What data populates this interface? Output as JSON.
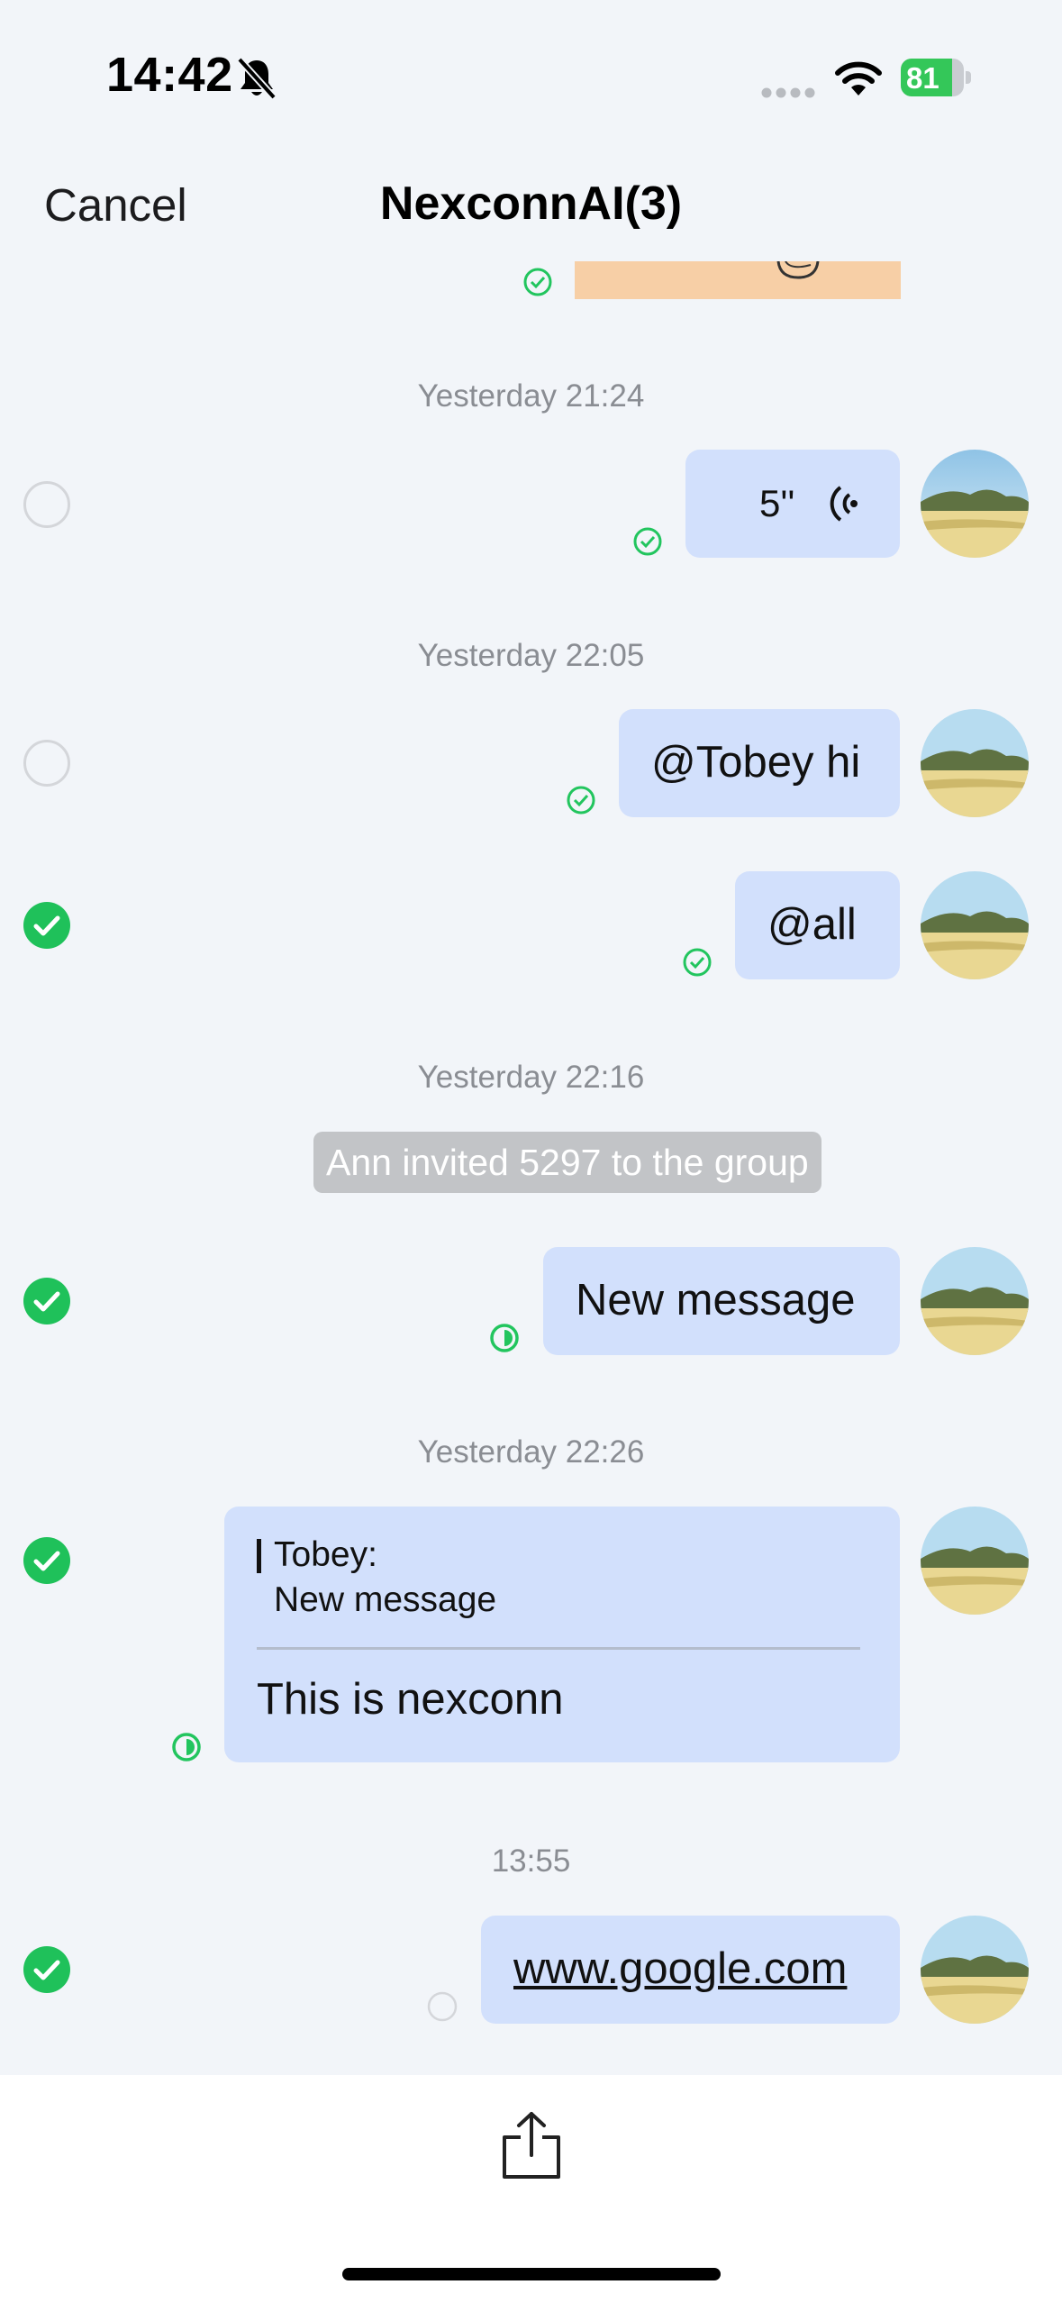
{
  "status_bar": {
    "time": "14:42",
    "battery_level": "81",
    "battery_fraction": 0.81
  },
  "nav": {
    "cancel_label": "Cancel",
    "title": "NexconnAI(3)"
  },
  "messages": [
    {
      "type": "image",
      "partial": true,
      "read_status": "read"
    },
    {
      "timestamp": "Yesterday 21:24"
    },
    {
      "type": "voice",
      "duration": "5''",
      "selected": false,
      "read_status": "read"
    },
    {
      "timestamp": "Yesterday 22:05"
    },
    {
      "type": "text",
      "text": "@Tobey hi",
      "selected": false,
      "read_status": "read"
    },
    {
      "type": "text",
      "text": "@all",
      "selected": true,
      "read_status": "read"
    },
    {
      "timestamp": "Yesterday 22:16"
    },
    {
      "type": "notice",
      "text": "Ann invited 5297 to the group"
    },
    {
      "type": "text",
      "text": "New message",
      "selected": true,
      "read_status": "partial"
    },
    {
      "timestamp": "Yesterday 22:26"
    },
    {
      "type": "reply",
      "quote_author": "Tobey:",
      "quote_text": "New message",
      "text": "This is nexconn",
      "selected": true,
      "read_status": "partial"
    },
    {
      "timestamp": "13:55"
    },
    {
      "type": "link",
      "text": "www.google.com",
      "selected": true,
      "read_status": "unread"
    }
  ],
  "colors": {
    "background": "#f2f5f9",
    "bubble": "#d2e0fc",
    "accent_green": "#1fc15a",
    "timestamp_gray": "#8a8d93",
    "notice_bg": "#c2c4c7"
  },
  "icons": {
    "status": [
      "bell-slash-icon",
      "signal-icon",
      "wifi-icon",
      "battery-icon"
    ],
    "bottom": [
      "share-icon"
    ],
    "bubble": [
      "voice-wave-icon",
      "read-check-icon",
      "partial-read-icon",
      "unread-circle-icon",
      "checkmark-icon"
    ]
  }
}
